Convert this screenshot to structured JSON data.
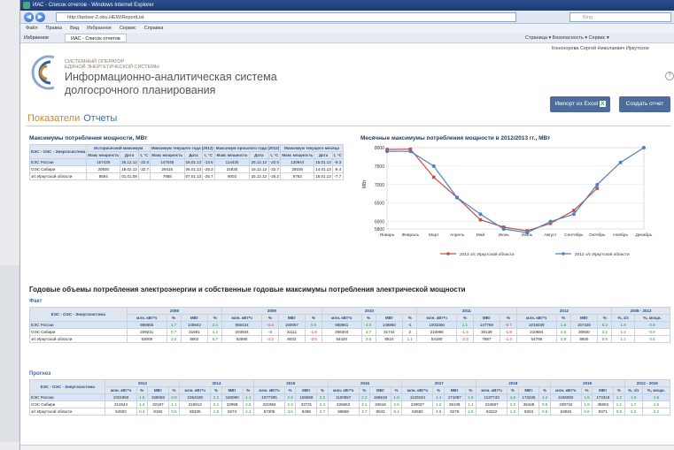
{
  "browser": {
    "title": "ИАС - Список отчетов - Windows Internet Explorer",
    "url": "http://lastser-2.obu.HEW/ReportList",
    "search": "Bing",
    "menu": [
      "Файл",
      "Правка",
      "Вид",
      "Избранное",
      "Сервис",
      "Справка"
    ],
    "fav_label": "Избранное",
    "tab_label": "ИАС - Список отчетов",
    "tools": "Страница ▾  Безопасность ▾  Сервис ▾"
  },
  "header": {
    "company1": "СИСТЕМНЫЙ ОПЕРАТОР",
    "company2": "ЕДИНОЙ ЭНЕРГЕТИЧЕСКОЙ СИСТЕМЫ",
    "title1": "Информационно-аналитическая система",
    "title2": "долгосрочного планирования",
    "user": "Кононорова Сергей Николаевич  Иркутское",
    "export_label": "Импорт из Excel",
    "create_label": "Создать отчет",
    "help": "?",
    "tab_a": "Показатели",
    "tab_b": "Отчеты",
    "accent": "#4b6c9c"
  },
  "max_table": {
    "title": "Максимумы потребления мощности, МВт",
    "group_headers": [
      "ЕЭС - ОЭС - Энергосистема",
      "Исторический максимум",
      "Максимум текущего года (2013)",
      "Максимум прошлого года (2012)",
      "Максимум текущего месяца"
    ],
    "sub_headers": [
      "Макс мощность",
      "Дата",
      "t, °C",
      "Макс мощность",
      "Дата",
      "t, °C",
      "Макс мощность",
      "Дата",
      "t, °C",
      "Макс мощность",
      "Дата",
      "t, °C"
    ],
    "rows": [
      {
        "name": "ЕЭС России",
        "v": [
          "157425",
          "25.12.12",
          "-22.5",
          "147045",
          "16.01.13",
          "-13.6",
          "114425",
          "25.12.12",
          "-22.5",
          "130944",
          "15.01.13",
          "-9.3"
        ]
      },
      {
        "name": "ОЭС Сибири",
        "v": [
          "30930",
          "18.02.12",
          "-32.7",
          "29415",
          "06.01.13",
          "-25.3",
          "31830",
          "18.12.12",
          "-32.7",
          "28036",
          "14.01.13",
          "-9.4"
        ]
      },
      {
        "name": "э/с Иркутской области",
        "v": [
          "8594",
          "01.01.09",
          "",
          "7958",
          "07.01.13",
          "-25.7",
          "9003",
          "25.12.12",
          "-26.2",
          "9763",
          "15.01.13",
          "-7.7"
        ]
      }
    ]
  },
  "chart_data": {
    "type": "line",
    "title": "Месячные максимумы потребления мощности в 2012/2013 гг., МВт",
    "ylabel": "МВт",
    "categories": [
      "Январь",
      "Февраль",
      "Март",
      "Апрель",
      "Май",
      "Июнь",
      "Июль",
      "Август",
      "Сентябрь",
      "Октябрь",
      "Ноябрь",
      "Декабрь"
    ],
    "ylim": [
      5800,
      8000
    ],
    "yticks": [
      5800,
      6000,
      6500,
      7000,
      7500,
      8000
    ],
    "legend_position": "bottom",
    "series": [
      {
        "name": "2013 э/с Иркутской области",
        "color": "#c0504d",
        "values": [
          7950,
          7960,
          7200,
          6650,
          6050,
          5850,
          5750,
          5950,
          6300,
          6900,
          null,
          null
        ]
      },
      {
        "name": "2012 э/с Иркутской области",
        "color": "#4f81bd",
        "values": [
          7900,
          7900,
          7500,
          6650,
          6200,
          5800,
          5700,
          6000,
          6200,
          7000,
          7600,
          8000
        ]
      }
    ]
  },
  "annual": {
    "title": "Годовые объемы потребления электроэнергии и собственные годовые максимумы потребления электрической мощности",
    "fact_label": "Факт",
    "forecast_label": "Прогноз",
    "row_header": "ЕЭС - ОЭС - Энергосистема",
    "fact_years": [
      "2008",
      "2009",
      "2010",
      "2011",
      "2012",
      "2008 - 2012"
    ],
    "fact_sub": [
      "млн. кВт*ч",
      "%",
      "МВт",
      "%",
      "млн. кВт*ч",
      "%",
      "МВт",
      "%",
      "млн. кВт*ч",
      "%",
      "МВт",
      "%",
      "млн. кВт*ч",
      "%",
      "МВт",
      "%",
      "млн. кВт*ч",
      "%",
      "МВт",
      "%",
      "%, з/з",
      "%, мощн."
    ],
    "fact_rows": [
      {
        "name": "ЕЭС России",
        "v": [
          "988665",
          "1.7",
          "149842",
          "2.4",
          "966434",
          "-4.4",
          "150067",
          "0.6",
          "988961",
          "4.0",
          "148860",
          "-1",
          "1003366",
          "1.1",
          "147769",
          "-0.7",
          "1016039",
          "1.6",
          "157425",
          "6.3",
          "1.6",
          "0.9"
        ]
      },
      {
        "name": "ОЭС Сибири",
        "v": [
          "209231",
          "0.7",
          "31691",
          "4.4",
          "203934",
          "-4",
          "31111",
          "-1.8",
          "206304",
          "3.7",
          "31744",
          "2",
          "210966",
          "-1.4",
          "30138",
          "-1.8",
          "210684",
          "2.5",
          "30930",
          "3.2",
          "1.4",
          "0.9"
        ]
      },
      {
        "name": "э/с Иркутской области",
        "v": [
          "53009",
          "3.4",
          "8002",
          "6.7",
          "52590",
          "-4.3",
          "8032",
          "-0.6",
          "54420",
          "3.6",
          "8510",
          "1.1",
          "53180",
          "-2.3",
          "7987",
          "-1.4",
          "54708",
          "2.9",
          "8930",
          "0.8",
          "1.1",
          "0.6"
        ]
      }
    ],
    "fc_years": [
      "2013",
      "2014",
      "2015",
      "2016",
      "2017",
      "2018",
      "2019",
      "2013 - 2019"
    ],
    "fc_sub": [
      "млн. кВт*ч",
      "%",
      "МВт",
      "%",
      "млн. кВт*ч",
      "%",
      "МВт",
      "%",
      "млн. кВт*ч",
      "%",
      "МВт",
      "%",
      "млн. кВт*ч",
      "%",
      "МВт",
      "%",
      "млн. кВт*ч",
      "%",
      "МВт",
      "%",
      "млн. кВт*ч",
      "%",
      "МВт",
      "%",
      "млн. кВт*ч",
      "%",
      "МВт",
      "%",
      "%, з/з",
      "%, мощн."
    ],
    "fc_rows": [
      {
        "name": "ЕЭС России",
        "v": [
          "1031960",
          "1.5",
          "158659",
          "0.8",
          "1054180",
          "2.2",
          "160090",
          "1.1",
          "1077295",
          "2.2",
          "165658",
          "3.2",
          "1100557",
          "2.2",
          "168619",
          "1.8",
          "1120224",
          "1.4",
          "171087",
          "1.5",
          "1137743",
          "1.6",
          "173226",
          "1.2",
          "1155082",
          "1.5",
          "173315",
          "1.2",
          "1.6",
          "1.6"
        ]
      },
      {
        "name": "ОЭС Сибири",
        "v": [
          "212544",
          "1.4",
          "32197",
          "1.1",
          "216913",
          "2.1",
          "32958",
          "2.3",
          "221984",
          "2.3",
          "33731",
          "2.4",
          "226653",
          "2.1",
          "34618",
          "2.6",
          "230027",
          "1.2",
          "35108",
          "1.4",
          "234557",
          "2.0",
          "35428",
          "0.9",
          "238732",
          "1.8",
          "35803",
          "1.1",
          "1.7",
          "1.6"
        ]
      },
      {
        "name": "э/с Иркутской области",
        "v": [
          "54502",
          "0.4",
          "8192",
          "0.6",
          "55325",
          "1.5",
          "8274",
          "2.1",
          "57305",
          "3.6",
          "8498",
          "2.7",
          "59668",
          "4.7",
          "9043",
          "6.4",
          "62582",
          "4.8",
          "9276",
          "2.6",
          "63322",
          "1.3",
          "9323",
          "0.5",
          "63846",
          "0.8",
          "9371",
          "0.5",
          "2.2",
          "2.2"
        ]
      }
    ]
  }
}
